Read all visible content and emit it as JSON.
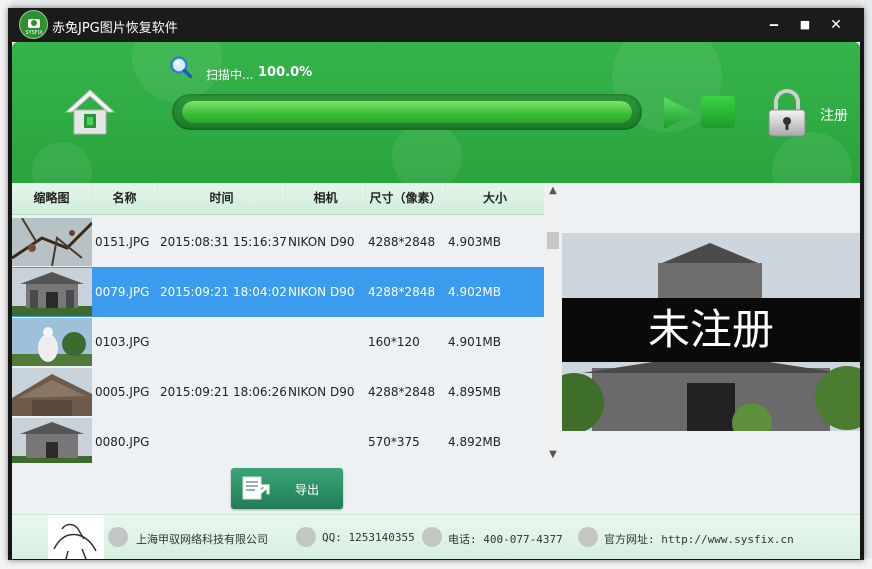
{
  "window": {
    "title": "赤兔JPG图片恢复软件",
    "icon_tag": "SYSFIX",
    "minimize_label": "‒",
    "maximize_label": "■",
    "close_label": "✕"
  },
  "scan": {
    "label": "扫描中...",
    "percent_text": "100.0%",
    "progress": 1.0
  },
  "register": {
    "label": "注册"
  },
  "table": {
    "columns": [
      "缩略图",
      "名称",
      "时间",
      "相机",
      "尺寸（像素）",
      "大小"
    ],
    "rows": [
      {
        "name": "0151.JPG",
        "time": "2015:08:31 15:16:37",
        "camera": "NIKON D90",
        "dims": "4288*2848",
        "size": "4.903MB",
        "thumb": "tree-branches"
      },
      {
        "name": "0079.JPG",
        "time": "2015:09:21 18:04:02",
        "camera": "NIKON D90",
        "dims": "4288*2848",
        "size": "4.902MB",
        "thumb": "temple-gate"
      },
      {
        "name": "0103.JPG",
        "time": "",
        "camera": "",
        "dims": "160*120",
        "size": "4.901MB",
        "thumb": "statue"
      },
      {
        "name": "0005.JPG",
        "time": "2015:09:21 18:06:26",
        "camera": "NIKON D90",
        "dims": "4288*2848",
        "size": "4.895MB",
        "thumb": "pagoda-roof"
      },
      {
        "name": "0080.JPG",
        "time": "",
        "camera": "",
        "dims": "570*375",
        "size": "4.892MB",
        "thumb": "temple-gate"
      }
    ],
    "selected_index": 1
  },
  "preview": {
    "watermark": "未注册"
  },
  "export": {
    "label": "导出"
  },
  "footer": {
    "company": "上海甲驭网络科技有限公司",
    "qq": "QQ: 1253140355",
    "phone": "电话: 400-077-4377",
    "website": "官方网址: http://www.sysfix.cn"
  },
  "colors": {
    "header_green": "#2faa44",
    "selected_row": "#3a9bef",
    "export_button": "#2e9166"
  }
}
